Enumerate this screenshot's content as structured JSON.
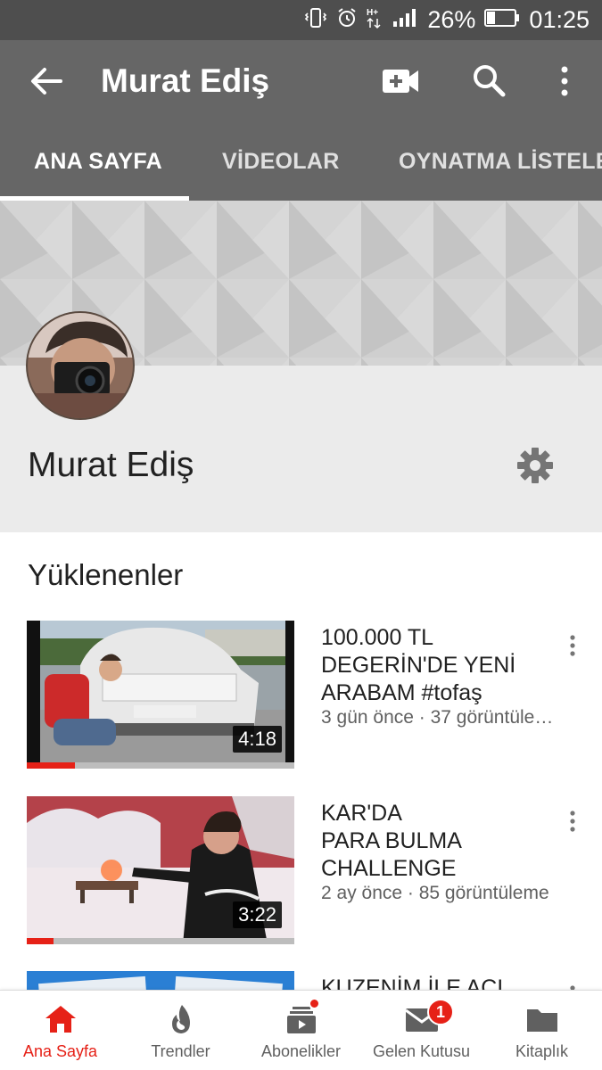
{
  "status_bar": {
    "battery": "26%",
    "time": "01:25",
    "network": "H+"
  },
  "app_bar": {
    "title": "Murat Ediş",
    "icons": [
      "back-arrow-icon",
      "video-camera-add-icon",
      "search-icon",
      "more-vertical-icon"
    ]
  },
  "tabs": [
    {
      "label": "ANA SAYFA",
      "active": true
    },
    {
      "label": "VİDEOLAR",
      "active": false
    },
    {
      "label": "OYNATMA LİSTELE",
      "active": false
    }
  ],
  "channel": {
    "name": "Murat Ediş"
  },
  "uploads": {
    "heading": "Yüklenenler",
    "videos": [
      {
        "title_lines": [
          "100.000 TL",
          "DEGERİN'DE YENİ",
          "ARABAM #tofaş"
        ],
        "meta": "3 gün önce · 37 görüntüle…",
        "duration": "4:18",
        "progress": 0.18
      },
      {
        "title_lines": [
          "KAR'DA",
          "PARA BULMA",
          "CHALLENGE"
        ],
        "meta": "2 ay önce · 85 görüntüleme",
        "duration": "3:22",
        "progress": 0.1
      },
      {
        "title_lines": [
          "KUZENİM İLE ACI"
        ],
        "meta": "",
        "duration": "",
        "progress": 0
      }
    ]
  },
  "bottom_nav": [
    {
      "label": "Ana Sayfa",
      "icon": "home-icon",
      "active": true
    },
    {
      "label": "Trendler",
      "icon": "fire-icon",
      "active": false
    },
    {
      "label": "Abonelikler",
      "icon": "subscriptions-icon",
      "active": false,
      "dot": true
    },
    {
      "label": "Gelen Kutusu",
      "icon": "mail-icon",
      "active": false,
      "badge": "1"
    },
    {
      "label": "Kitaplık",
      "icon": "folder-icon",
      "active": false
    }
  ],
  "colors": {
    "app_bar": "#666666",
    "status_bar": "#4e4e4e",
    "accent": "#e62117"
  }
}
